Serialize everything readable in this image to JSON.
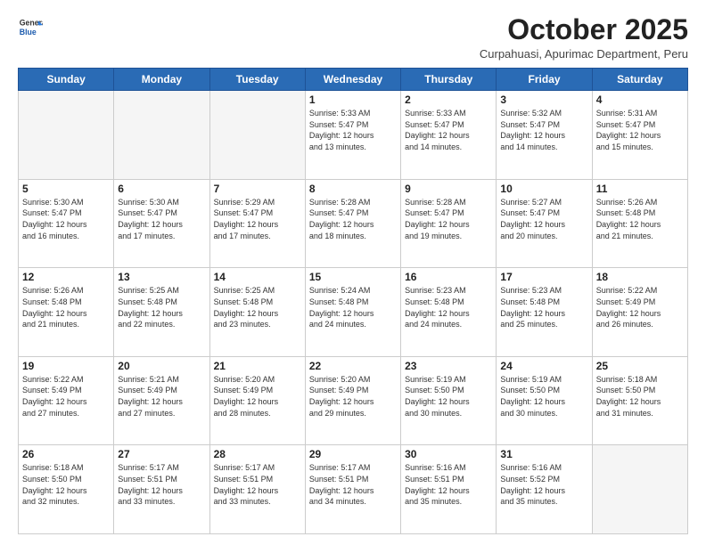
{
  "logo": {
    "line1": "General",
    "line2": "Blue"
  },
  "header": {
    "month": "October 2025",
    "location": "Curpahuasi, Apurimac Department, Peru"
  },
  "weekdays": [
    "Sunday",
    "Monday",
    "Tuesday",
    "Wednesday",
    "Thursday",
    "Friday",
    "Saturday"
  ],
  "weeks": [
    [
      {
        "day": "",
        "info": ""
      },
      {
        "day": "",
        "info": ""
      },
      {
        "day": "",
        "info": ""
      },
      {
        "day": "1",
        "info": "Sunrise: 5:33 AM\nSunset: 5:47 PM\nDaylight: 12 hours\nand 13 minutes."
      },
      {
        "day": "2",
        "info": "Sunrise: 5:33 AM\nSunset: 5:47 PM\nDaylight: 12 hours\nand 14 minutes."
      },
      {
        "day": "3",
        "info": "Sunrise: 5:32 AM\nSunset: 5:47 PM\nDaylight: 12 hours\nand 14 minutes."
      },
      {
        "day": "4",
        "info": "Sunrise: 5:31 AM\nSunset: 5:47 PM\nDaylight: 12 hours\nand 15 minutes."
      }
    ],
    [
      {
        "day": "5",
        "info": "Sunrise: 5:30 AM\nSunset: 5:47 PM\nDaylight: 12 hours\nand 16 minutes."
      },
      {
        "day": "6",
        "info": "Sunrise: 5:30 AM\nSunset: 5:47 PM\nDaylight: 12 hours\nand 17 minutes."
      },
      {
        "day": "7",
        "info": "Sunrise: 5:29 AM\nSunset: 5:47 PM\nDaylight: 12 hours\nand 17 minutes."
      },
      {
        "day": "8",
        "info": "Sunrise: 5:28 AM\nSunset: 5:47 PM\nDaylight: 12 hours\nand 18 minutes."
      },
      {
        "day": "9",
        "info": "Sunrise: 5:28 AM\nSunset: 5:47 PM\nDaylight: 12 hours\nand 19 minutes."
      },
      {
        "day": "10",
        "info": "Sunrise: 5:27 AM\nSunset: 5:47 PM\nDaylight: 12 hours\nand 20 minutes."
      },
      {
        "day": "11",
        "info": "Sunrise: 5:26 AM\nSunset: 5:48 PM\nDaylight: 12 hours\nand 21 minutes."
      }
    ],
    [
      {
        "day": "12",
        "info": "Sunrise: 5:26 AM\nSunset: 5:48 PM\nDaylight: 12 hours\nand 21 minutes."
      },
      {
        "day": "13",
        "info": "Sunrise: 5:25 AM\nSunset: 5:48 PM\nDaylight: 12 hours\nand 22 minutes."
      },
      {
        "day": "14",
        "info": "Sunrise: 5:25 AM\nSunset: 5:48 PM\nDaylight: 12 hours\nand 23 minutes."
      },
      {
        "day": "15",
        "info": "Sunrise: 5:24 AM\nSunset: 5:48 PM\nDaylight: 12 hours\nand 24 minutes."
      },
      {
        "day": "16",
        "info": "Sunrise: 5:23 AM\nSunset: 5:48 PM\nDaylight: 12 hours\nand 24 minutes."
      },
      {
        "day": "17",
        "info": "Sunrise: 5:23 AM\nSunset: 5:48 PM\nDaylight: 12 hours\nand 25 minutes."
      },
      {
        "day": "18",
        "info": "Sunrise: 5:22 AM\nSunset: 5:49 PM\nDaylight: 12 hours\nand 26 minutes."
      }
    ],
    [
      {
        "day": "19",
        "info": "Sunrise: 5:22 AM\nSunset: 5:49 PM\nDaylight: 12 hours\nand 27 minutes."
      },
      {
        "day": "20",
        "info": "Sunrise: 5:21 AM\nSunset: 5:49 PM\nDaylight: 12 hours\nand 27 minutes."
      },
      {
        "day": "21",
        "info": "Sunrise: 5:20 AM\nSunset: 5:49 PM\nDaylight: 12 hours\nand 28 minutes."
      },
      {
        "day": "22",
        "info": "Sunrise: 5:20 AM\nSunset: 5:49 PM\nDaylight: 12 hours\nand 29 minutes."
      },
      {
        "day": "23",
        "info": "Sunrise: 5:19 AM\nSunset: 5:50 PM\nDaylight: 12 hours\nand 30 minutes."
      },
      {
        "day": "24",
        "info": "Sunrise: 5:19 AM\nSunset: 5:50 PM\nDaylight: 12 hours\nand 30 minutes."
      },
      {
        "day": "25",
        "info": "Sunrise: 5:18 AM\nSunset: 5:50 PM\nDaylight: 12 hours\nand 31 minutes."
      }
    ],
    [
      {
        "day": "26",
        "info": "Sunrise: 5:18 AM\nSunset: 5:50 PM\nDaylight: 12 hours\nand 32 minutes."
      },
      {
        "day": "27",
        "info": "Sunrise: 5:17 AM\nSunset: 5:51 PM\nDaylight: 12 hours\nand 33 minutes."
      },
      {
        "day": "28",
        "info": "Sunrise: 5:17 AM\nSunset: 5:51 PM\nDaylight: 12 hours\nand 33 minutes."
      },
      {
        "day": "29",
        "info": "Sunrise: 5:17 AM\nSunset: 5:51 PM\nDaylight: 12 hours\nand 34 minutes."
      },
      {
        "day": "30",
        "info": "Sunrise: 5:16 AM\nSunset: 5:51 PM\nDaylight: 12 hours\nand 35 minutes."
      },
      {
        "day": "31",
        "info": "Sunrise: 5:16 AM\nSunset: 5:52 PM\nDaylight: 12 hours\nand 35 minutes."
      },
      {
        "day": "",
        "info": ""
      }
    ]
  ]
}
